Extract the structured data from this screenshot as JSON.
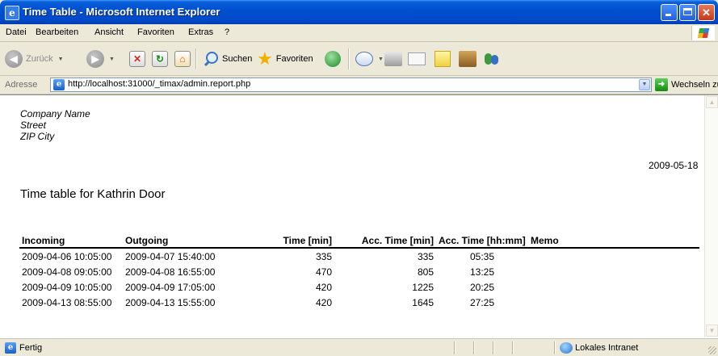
{
  "window": {
    "title": "Time Table - Microsoft Internet Explorer",
    "minimize_icon": "minimize-icon",
    "maximize_icon": "maximize-icon",
    "close_icon": "close-icon"
  },
  "menu": {
    "items": [
      "Datei",
      "Bearbeiten",
      "Ansicht",
      "Favoriten",
      "Extras",
      "?"
    ]
  },
  "toolbar": {
    "back_label": "Zurück",
    "search_label": "Suchen",
    "favorites_label": "Favoriten"
  },
  "address": {
    "label": "Adresse",
    "url": "http://localhost:31000/_timax/admin.report.php",
    "go_label": "Wechseln zu"
  },
  "report": {
    "company_lines": [
      "Company Name",
      "Street",
      "ZIP City"
    ],
    "date": "2009-05-18",
    "title": "Time table for Kathrin Door",
    "columns": [
      "Incoming",
      "Outgoing",
      "Time [min]",
      "Acc. Time [min]",
      "Acc. Time [hh:mm]",
      "Memo"
    ],
    "rows": [
      [
        "2009-04-06 10:05:00",
        "2009-04-07 15:40:00",
        "335",
        "335",
        "05:35",
        ""
      ],
      [
        "2009-04-08 09:05:00",
        "2009-04-08 16:55:00",
        "470",
        "805",
        "13:25",
        ""
      ],
      [
        "2009-04-09 10:05:00",
        "2009-04-09 17:05:00",
        "420",
        "1225",
        "20:25",
        ""
      ],
      [
        "2009-04-13 08:55:00",
        "2009-04-13 15:55:00",
        "420",
        "1645",
        "27:25",
        ""
      ]
    ]
  },
  "status": {
    "text": "Fertig",
    "zone": "Lokales Intranet"
  }
}
